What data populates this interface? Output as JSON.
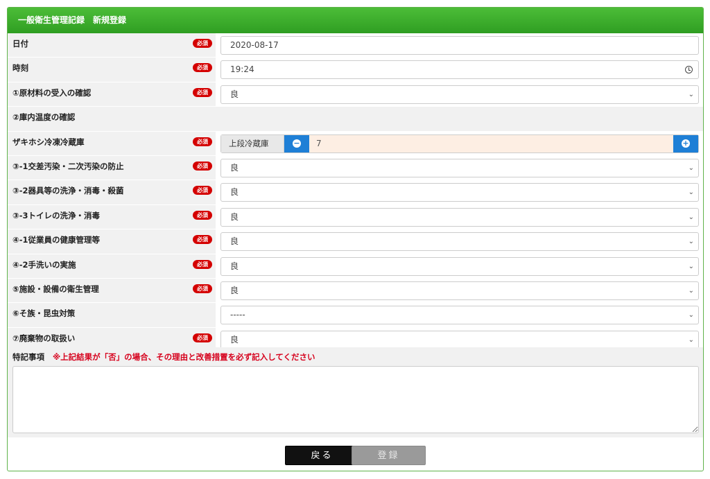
{
  "header": {
    "title": "一般衛生管理記録　新規登録"
  },
  "required_label": "必須",
  "chevron": "⌄",
  "rows": {
    "date": {
      "label": "日付",
      "value": "2020-08-17"
    },
    "time": {
      "label": "時刻",
      "value": "19:24"
    },
    "raw_material": {
      "label": "①原材料の受入の確認",
      "value": "良"
    },
    "temp_section": {
      "label": "②庫内温度の確認"
    },
    "freezer": {
      "label": "ザキホシ冷凍冷蔵庫",
      "addon": "上段冷蔵庫",
      "value": "7",
      "minus": "−",
      "plus": "+"
    },
    "cross": {
      "label": "③-1交差汚染・二次汚染の防止",
      "value": "良"
    },
    "utensils": {
      "label": "③-2器具等の洗浄・消毒・殺菌",
      "value": "良"
    },
    "toilet": {
      "label": "③-3トイレの洗浄・消毒",
      "value": "良"
    },
    "health": {
      "label": "④-1従業員の健康管理等",
      "value": "良"
    },
    "handwash": {
      "label": "④-2手洗いの実施",
      "value": "良"
    },
    "facility": {
      "label": "⑤施設・設備の衛生管理",
      "value": "良"
    },
    "pests": {
      "label": "⑥そ族・昆虫対策",
      "value": "-----"
    },
    "waste": {
      "label": "⑦廃棄物の取扱い",
      "value": "良"
    }
  },
  "notes": {
    "label": "特記事項",
    "warning": "※上記結果が「否」の場合、その理由と改善措置を必ず記入してください",
    "value": ""
  },
  "buttons": {
    "back": "戻る",
    "save": "登録"
  }
}
